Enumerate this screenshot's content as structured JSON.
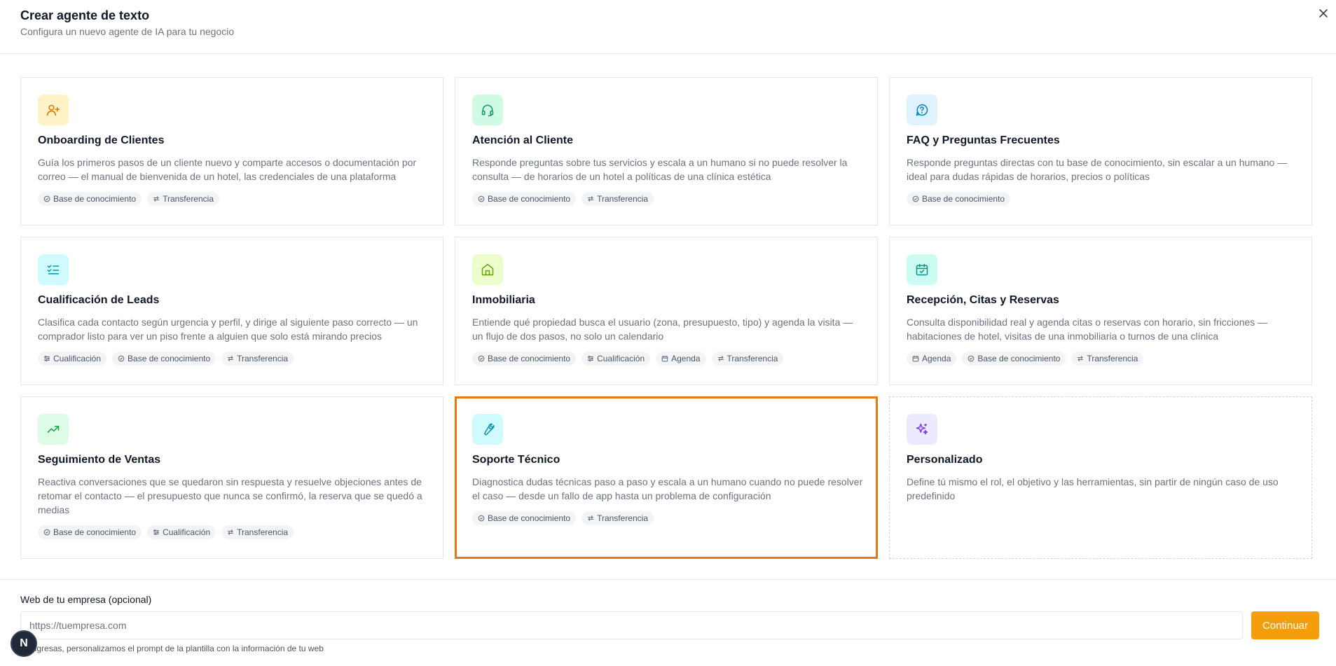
{
  "header": {
    "title": "Crear agente de texto",
    "subtitle": "Configura un nuevo agente de IA para tu negocio"
  },
  "colors": {
    "accent": "#f59e0b",
    "selected_border": "#e57a14"
  },
  "cards": [
    {
      "title": "Onboarding de Clientes",
      "description": "Guía los primeros pasos de un cliente nuevo y comparte accesos o documentación por correo — el manual de bienvenida de un hotel, las credenciales de una plataforma",
      "icon": "user-plus-icon",
      "tags": [
        "Base de conocimiento",
        "Transferencia"
      ]
    },
    {
      "title": "Atención al Cliente",
      "description": "Responde preguntas sobre tus servicios y escala a un humano si no puede resolver la consulta — de horarios de un hotel a políticas de una clínica estética",
      "icon": "headset-icon",
      "tags": [
        "Base de conocimiento",
        "Transferencia"
      ]
    },
    {
      "title": "FAQ y Preguntas Frecuentes",
      "description": "Responde preguntas directas con tu base de conocimiento, sin escalar a un humano — ideal para dudas rápidas de horarios, precios o políticas",
      "icon": "help-circle-icon",
      "tags": [
        "Base de conocimiento"
      ]
    },
    {
      "title": "Cualificación de Leads",
      "description": "Clasifica cada contacto según urgencia y perfil, y dirige al siguiente paso correcto — un comprador listo para ver un piso frente a alguien que solo está mirando precios",
      "icon": "list-checks-icon",
      "tags": [
        "Cualificación",
        "Base de conocimiento",
        "Transferencia"
      ]
    },
    {
      "title": "Inmobiliaria",
      "description": "Entiende qué propiedad busca el usuario (zona, presupuesto, tipo) y agenda la visita — un flujo de dos pasos, no solo un calendario",
      "icon": "home-icon",
      "tags": [
        "Base de conocimiento",
        "Cualificación",
        "Agenda",
        "Transferencia"
      ]
    },
    {
      "title": "Recepción, Citas y Reservas",
      "description": "Consulta disponibilidad real y agenda citas o reservas con horario, sin fricciones — habitaciones de hotel, visitas de una inmobiliaria o turnos de una clínica",
      "icon": "calendar-check-icon",
      "tags": [
        "Agenda",
        "Base de conocimiento",
        "Transferencia"
      ]
    },
    {
      "title": "Seguimiento de Ventas",
      "description": "Reactiva conversaciones que se quedaron sin respuesta y resuelve objeciones antes de retomar el contacto — el presupuesto que nunca se confirmó, la reserva que se quedó a medias",
      "icon": "trending-up-icon",
      "tags": [
        "Base de conocimiento",
        "Cualificación",
        "Transferencia"
      ]
    },
    {
      "title": "Soporte Técnico",
      "description": "Diagnostica dudas técnicas paso a paso y escala a un humano cuando no puede resolver el caso — desde un fallo de app hasta un problema de configuración",
      "icon": "wrench-icon",
      "tags": [
        "Base de conocimiento",
        "Transferencia"
      ],
      "selected": true
    },
    {
      "title": "Personalizado",
      "description": "Define tú mismo el rol, el objetivo y las herramientas, sin partir de ningún caso de uso predefinido",
      "icon": "sparkles-icon",
      "tags": []
    }
  ],
  "footer": {
    "web_label": "Web de tu empresa (opcional)",
    "web_placeholder": "https://tuempresa.com",
    "continue_label": "Continuar",
    "hint": "Si ingresas, personalizamos el prompt de la plantilla con la información de tu web",
    "badge": "N"
  }
}
